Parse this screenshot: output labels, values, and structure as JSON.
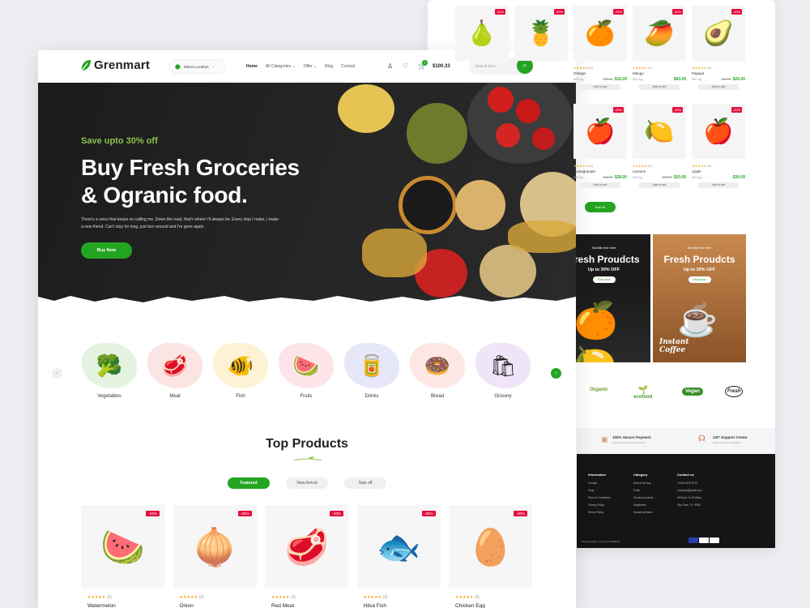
{
  "header": {
    "brand": "Grenmart",
    "location_label": "Select Location",
    "nav": [
      "Home",
      "All Categories",
      "Offer",
      "Blog",
      "Contact"
    ],
    "cart_count": "0",
    "cart_total": "$100.33",
    "search_placeholder": "Search here....",
    "accent": "#23a522"
  },
  "hero": {
    "eyebrow": "Save upto 30% off",
    "title_line1": "Buy Fresh Groceries",
    "title_line2": "& Ogranic food.",
    "description": "There's a voice that keeps on calling me. Down the road, that's where I'll always be. Every stop I make, I make a new friend. Can't stay for long, just turn around and I'm gone again.",
    "cta": "Buy Now"
  },
  "categories": [
    {
      "label": "Vegetables",
      "icon": "🥦",
      "color": "#e3f3df"
    },
    {
      "label": "Meat",
      "icon": "🥩",
      "color": "#fbe4e4"
    },
    {
      "label": "Fish",
      "icon": "🐠",
      "color": "#fdf3d4"
    },
    {
      "label": "Fruits",
      "icon": "🍉",
      "color": "#fde4e8"
    },
    {
      "label": "Drinks",
      "icon": "🥫",
      "color": "#e6e7f8"
    },
    {
      "label": "Bread",
      "icon": "🍩",
      "color": "#fde7e4"
    },
    {
      "label": "Grocery",
      "icon": "🛍",
      "color": "#efe4f8"
    }
  ],
  "top_products": {
    "title": "Top Products",
    "tabs": [
      "Featured",
      "New Arrival",
      "Sale off"
    ],
    "items": [
      {
        "name": "Watermelon",
        "badge": "-20%",
        "icon": "🍉",
        "reviews": "(3)"
      },
      {
        "name": "Onion",
        "badge": "-20%",
        "icon": "🧅",
        "reviews": "(3)"
      },
      {
        "name": "Red Meat",
        "badge": "-20%",
        "icon": "🥩",
        "reviews": "(3)"
      },
      {
        "name": "Hilsa Fish",
        "badge": "-20%",
        "icon": "🐟",
        "reviews": "(3)"
      },
      {
        "name": "Chicken Egg",
        "badge": "-20%",
        "icon": "🥚",
        "reviews": "(3)"
      }
    ]
  },
  "back_panel": {
    "products_row1": [
      {
        "name": "",
        "badge": "-20%",
        "icon": "🍐"
      },
      {
        "name": "",
        "badge": "-20%",
        "icon": "🍍"
      },
      {
        "name": "Orange",
        "badge": "-20%",
        "icon": "🍊",
        "weight": "500 kg",
        "old": "$30.00",
        "price": "$16.00",
        "reviews": "(3)"
      },
      {
        "name": "Mango",
        "badge": "-20%",
        "icon": "🥭",
        "weight": "500 kg",
        "old": "",
        "price": "$60.00",
        "reviews": "(3)"
      },
      {
        "name": "Papaya",
        "badge": "-20%",
        "icon": "🥑",
        "weight": "500 kg",
        "old": "$30.00",
        "price": "$20.00",
        "reviews": "(3)"
      }
    ],
    "products_row2": [
      {
        "name": "Pomegranate",
        "badge": "-20%",
        "icon": "🍎",
        "weight": "500 kg",
        "old": "$35.00",
        "price": "$28.00",
        "reviews": "(3)"
      },
      {
        "name": "Lemons",
        "badge": "-20%",
        "icon": "🍋",
        "weight": "500 kg",
        "old": "$30.00",
        "price": "$20.00",
        "reviews": "(3)"
      },
      {
        "name": "Apple",
        "badge": "-20%",
        "icon": "🍎",
        "weight": "500 kg",
        "old": "",
        "price": "$30.00",
        "reviews": "(3)"
      }
    ],
    "add_to_cart": "Add to cart",
    "sell_all": "See All",
    "promo1": {
      "sub": "Subtitle text here",
      "title": "Fresh Proudcts",
      "offer": "Up to 30% OFF",
      "cta": "Shop Now"
    },
    "promo2": {
      "sub": "Subtitle text here",
      "title": "Fresh Proudcts",
      "offer": "Up to 30% OFF",
      "cta": "Shop Now",
      "image_text": "Instant Coffee"
    },
    "brands": [
      "Organic",
      "ecofood",
      "Vegan",
      "Fresh"
    ],
    "trust": [
      {
        "title": "100% Secure Payment",
        "sub": "We ensure secure transactions"
      },
      {
        "title": "24/7 Support Center",
        "sub": "Support anytime available"
      }
    ],
    "footer": {
      "info_title": "Information",
      "info_links": [
        "Contact",
        "Faqs",
        "Terms & Conditions",
        "Privacy Policy",
        "Return Policy"
      ],
      "cat_title": "Category",
      "cat_links": [
        "Deal of the day",
        "Fruits",
        "Grocery products",
        "Vegetables",
        "Household items"
      ],
      "contact_title": "Contact us",
      "contact_lines": [
        "+1234 5678 9173",
        "company@gmail.com",
        "09:00am To 10:00pm",
        "Oqu Park, TX 75000"
      ],
      "copyright": "Privacy Policy | Terms & Conditions"
    }
  }
}
